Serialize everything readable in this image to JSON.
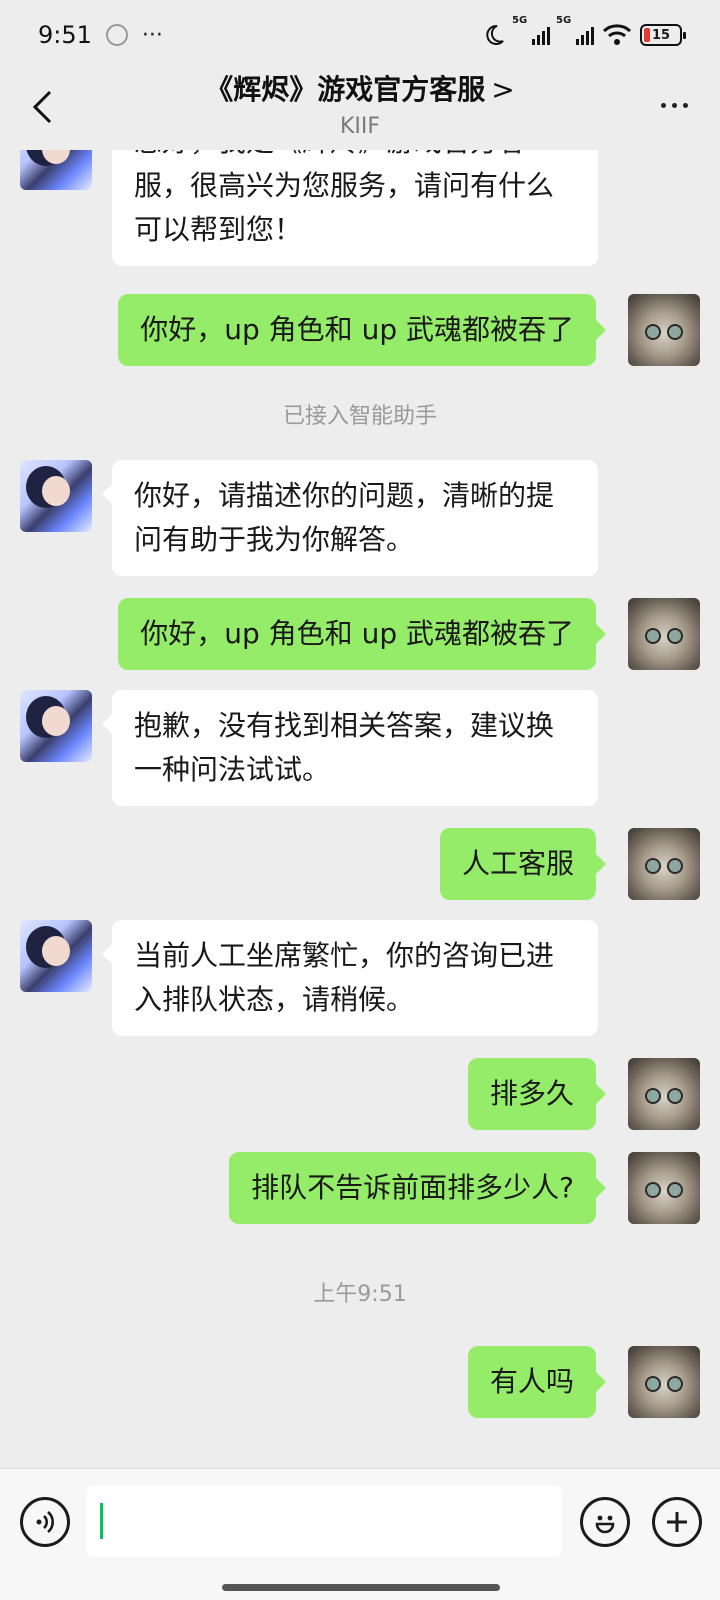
{
  "status_bar": {
    "time": "9:51",
    "more": "···",
    "signal_1_tag": "5G",
    "signal_2_tag": "5G",
    "battery_level": "15"
  },
  "nav": {
    "title": "《辉烬》游戏官方客服",
    "title_chevron": ">",
    "subtitle": "KIIF"
  },
  "messages": [
    {
      "side": "in",
      "text": "您好，我是《辉烬》游戏官方客服，很高兴为您服务，请问有什么可以帮到您！"
    },
    {
      "side": "out",
      "text": "你好，up 角色和 up 武魂都被吞了"
    },
    {
      "side": "system",
      "text": "已接入智能助手"
    },
    {
      "side": "in",
      "text": "你好，请描述你的问题，清晰的提问有助于我为你解答。"
    },
    {
      "side": "out",
      "text": "你好，up 角色和 up 武魂都被吞了"
    },
    {
      "side": "in",
      "text": "抱歉，没有找到相关答案，建议换一种问法试试。"
    },
    {
      "side": "out",
      "text": "人工客服"
    },
    {
      "side": "in",
      "text": "当前人工坐席繁忙，你的咨询已进入排队状态，请稍候。"
    },
    {
      "side": "out",
      "text": "排多久"
    },
    {
      "side": "out",
      "text": "排队不告诉前面排多少人?"
    },
    {
      "side": "timestamp",
      "text": "上午9:51"
    },
    {
      "side": "out",
      "text": "有人吗"
    }
  ],
  "input": {
    "value": ""
  },
  "icons": {
    "back": "back-arrow-icon",
    "more": "more-dots-icon",
    "voice": "voice-icon",
    "emoji": "emoji-icon",
    "plus": "plus-icon"
  }
}
